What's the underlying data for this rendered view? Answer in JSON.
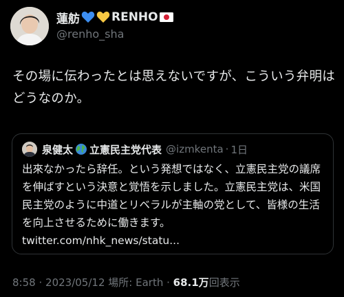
{
  "author": {
    "name": "蓮舫",
    "name_suffix": "RENHO",
    "handle": "@renho_sha",
    "emoji": [
      "blue-heart-icon",
      "yellow-heart-icon",
      "japan-flag-icon"
    ]
  },
  "tweet": {
    "text": "その場に伝わったとは思えないですが、こういう弁明はどうなのか。"
  },
  "quote": {
    "name": "泉健太",
    "org": "立憲民主党代表",
    "handle": "@izmkenta",
    "separator": "·",
    "time": "1日",
    "text": "出來なかったら辞任。という発想ではなく、立憲民主党の議席を伸ばすという決意と覚悟を示しました。立憲民主党は、米国民主党のように中道とリベラルが主軸の党として、皆様の生活を向上させるために働きます。",
    "link": "twitter.com/nhk_news/statu..."
  },
  "meta": {
    "time": "8:58",
    "dot1": "·",
    "date": "2023/05/12",
    "location_label": "場所: Earth",
    "dot2": "·",
    "views": "68.1万",
    "views_label": "回表示"
  },
  "colors": {
    "background": "#000000",
    "text": "#e7e9ea",
    "secondary": "#71767b",
    "border": "#2f3336"
  }
}
